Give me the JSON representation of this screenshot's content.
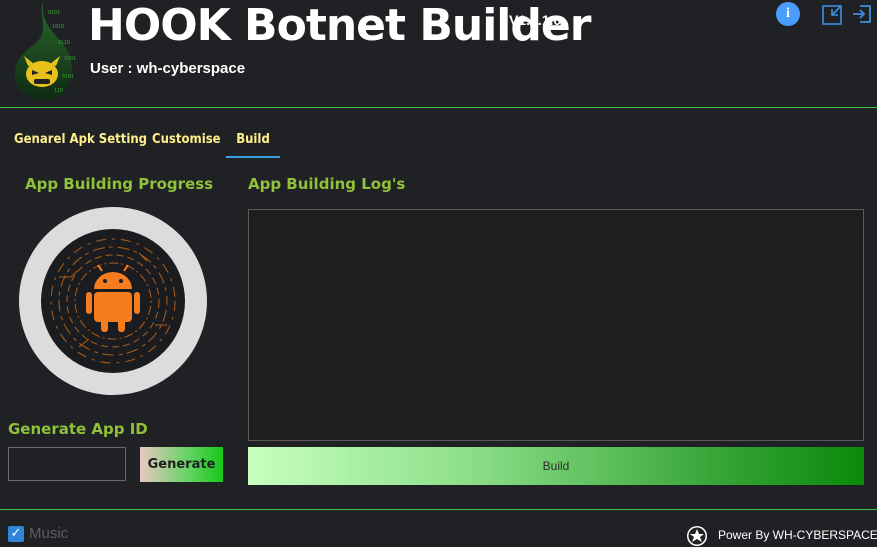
{
  "header": {
    "title": "HOOK Botnet Builder",
    "version": "V1.0.1.0",
    "user": "User : wh-cyberspace",
    "icons": [
      "info-icon",
      "minimize-icon",
      "exit-icon"
    ]
  },
  "tabs": [
    {
      "label": "Genarel Apk Setting",
      "active": false
    },
    {
      "label": "Customise",
      "active": false
    },
    {
      "label": "Build",
      "active": true
    }
  ],
  "progress": {
    "heading": "App Building Progress",
    "icon": "android-icon"
  },
  "log": {
    "heading": "App Building Log's",
    "content": ""
  },
  "app_id": {
    "heading": "Generate App ID",
    "value": "",
    "generate_label": "Generate"
  },
  "build": {
    "label": "Build"
  },
  "footer": {
    "music_label": "Music",
    "music_checked": true,
    "powered_by": "Power By WH-CYBERSPACE"
  },
  "colors": {
    "background": "#1f2124",
    "accent_green": "#3fc23f",
    "tab_text": "#ffef8a",
    "section_heading": "#8fc23a",
    "android": "#f57c1f"
  }
}
